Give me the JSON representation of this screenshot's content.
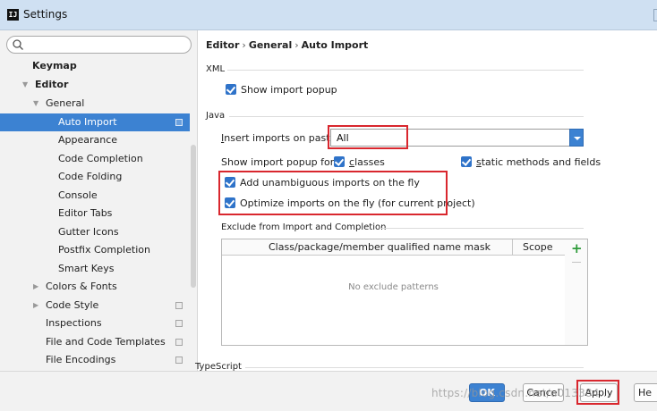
{
  "window": {
    "app_icon": "IJ",
    "title": "Settings"
  },
  "search": {
    "placeholder": "",
    "value": ""
  },
  "sidebar": {
    "items": [
      {
        "label": "Keymap",
        "bold": true,
        "expanded": null,
        "project": false
      },
      {
        "label": "Editor",
        "bold": true,
        "expanded": true,
        "project": false
      },
      {
        "label": "General",
        "bold": false,
        "expanded": true,
        "project": false
      },
      {
        "label": "Auto Import",
        "bold": false,
        "expanded": null,
        "project": true,
        "selected": true
      },
      {
        "label": "Appearance",
        "bold": false,
        "expanded": null,
        "project": false
      },
      {
        "label": "Code Completion",
        "bold": false,
        "expanded": null,
        "project": false
      },
      {
        "label": "Code Folding",
        "bold": false,
        "expanded": null,
        "project": false
      },
      {
        "label": "Console",
        "bold": false,
        "expanded": null,
        "project": false
      },
      {
        "label": "Editor Tabs",
        "bold": false,
        "expanded": null,
        "project": false
      },
      {
        "label": "Gutter Icons",
        "bold": false,
        "expanded": null,
        "project": false
      },
      {
        "label": "Postfix Completion",
        "bold": false,
        "expanded": null,
        "project": false
      },
      {
        "label": "Smart Keys",
        "bold": false,
        "expanded": null,
        "project": false
      },
      {
        "label": "Colors & Fonts",
        "bold": false,
        "expanded": false,
        "project": false
      },
      {
        "label": "Code Style",
        "bold": false,
        "expanded": false,
        "project": true
      },
      {
        "label": "Inspections",
        "bold": false,
        "expanded": null,
        "project": true
      },
      {
        "label": "File and Code Templates",
        "bold": false,
        "expanded": null,
        "project": true
      },
      {
        "label": "File Encodings",
        "bold": false,
        "expanded": null,
        "project": true
      }
    ]
  },
  "breadcrumb": [
    "Editor",
    "General",
    "Auto Import"
  ],
  "breadcrumb_separator": "›",
  "xml": {
    "section": "XML",
    "show_import_popup": {
      "label": "Show import popup",
      "checked": true
    }
  },
  "java": {
    "section": "Java",
    "insert_label_u": "I",
    "insert_label_rest": "nsert imports on paste:",
    "insert_value": "All",
    "popup_for_label": "Show import popup for:",
    "classes": {
      "label_u": "c",
      "label_rest": "lasses",
      "checked": true
    },
    "static": {
      "label_u": "s",
      "label_rest": "tatic methods and fields",
      "checked": true
    },
    "add_unambiguous": {
      "label": "Add unambiguous imports on the fly",
      "checked": true
    },
    "optimize": {
      "label": "Optimize imports on the fly (for current project)",
      "checked": true
    }
  },
  "exclude": {
    "section": "Exclude from Import and Completion",
    "col_mask": "Class/package/member qualified name mask",
    "col_scope": "Scope",
    "empty_text": "No exclude patterns"
  },
  "typescript_section": "TypeScript",
  "buttons": {
    "ok": "OK",
    "cancel": "Cancel",
    "apply": "Apply",
    "help": "He"
  },
  "watermark": "https://blog.csdn.net/u013384…",
  "colors": {
    "selection": "#3c82d2",
    "highlight": "#d9272e",
    "checkbox": "#2f73c9"
  }
}
